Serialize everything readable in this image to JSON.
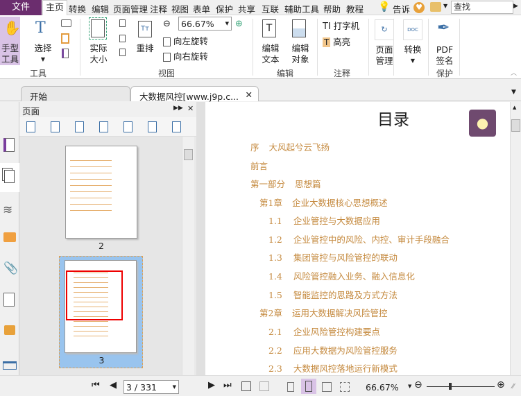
{
  "menu": {
    "file": "文件",
    "home": "主页",
    "items": [
      "转换",
      "编辑",
      "页面管理",
      "注释",
      "视图",
      "表单",
      "保护",
      "共享",
      "互联",
      "辅助工具",
      "帮助",
      "教程"
    ],
    "tell": "告诉",
    "search_placeholder": "查找"
  },
  "ribbon": {
    "hand": "手型\n工具",
    "select": "选择",
    "tools_group": "工具",
    "actual_size": "实际\n大小",
    "reflow": "重排",
    "zoom_value": "66.67%",
    "rotate_left": "向左旋转",
    "rotate_right": "向右旋转",
    "view_group": "视图",
    "edit_text": "编辑\n文本",
    "edit_object": "编辑\n对象",
    "edit_group": "编辑",
    "typewriter": "打字机",
    "highlight": "高亮",
    "comment_group": "注释",
    "page_manage": "页面\n管理",
    "convert": "转换",
    "pdf_sign": "PDF\n签名",
    "protect_group": "保护"
  },
  "tabs": [
    {
      "label": "开始"
    },
    {
      "label": "大数据风控[www.j9p.c..."
    }
  ],
  "panel": {
    "title": "页面",
    "pages": [
      {
        "number": "2"
      },
      {
        "number": "3"
      }
    ]
  },
  "document": {
    "title": "目录",
    "toc": [
      {
        "num": "序",
        "text": "大风起兮云飞扬",
        "level": 0
      },
      {
        "num": "",
        "text": "前言",
        "level": 0
      },
      {
        "num": "第一部分",
        "text": "思想篇",
        "level": 0
      },
      {
        "num": "第1章",
        "text": "企业大数据核心思想概述",
        "level": 1
      },
      {
        "num": "1.1",
        "text": "企业管控与大数据应用",
        "level": 2
      },
      {
        "num": "1.2",
        "text": "企业管控中的风险、内控、审计手段融合",
        "level": 2
      },
      {
        "num": "1.3",
        "text": "集团管控与风险管控的联动",
        "level": 2
      },
      {
        "num": "1.4",
        "text": "风险管控融入业务、融入信息化",
        "level": 2
      },
      {
        "num": "1.5",
        "text": "智能监控的思路及方式方法",
        "level": 2
      },
      {
        "num": "第2章",
        "text": "运用大数据解决风险管控",
        "level": 1
      },
      {
        "num": "2.1",
        "text": "企业风险管控构建要点",
        "level": 2
      },
      {
        "num": "2.2",
        "text": "应用大数据为风险管控服务",
        "level": 2
      },
      {
        "num": "2.3",
        "text": "大数据风控落地运行新模式",
        "level": 2
      }
    ]
  },
  "status": {
    "page_value": "3 / 331",
    "zoom": "66.67%",
    "zoom_fraction": 0.33
  },
  "colors": {
    "accent": "#6b2d6e",
    "toc": "#c58a3f",
    "selected": "#d9c3e6"
  }
}
